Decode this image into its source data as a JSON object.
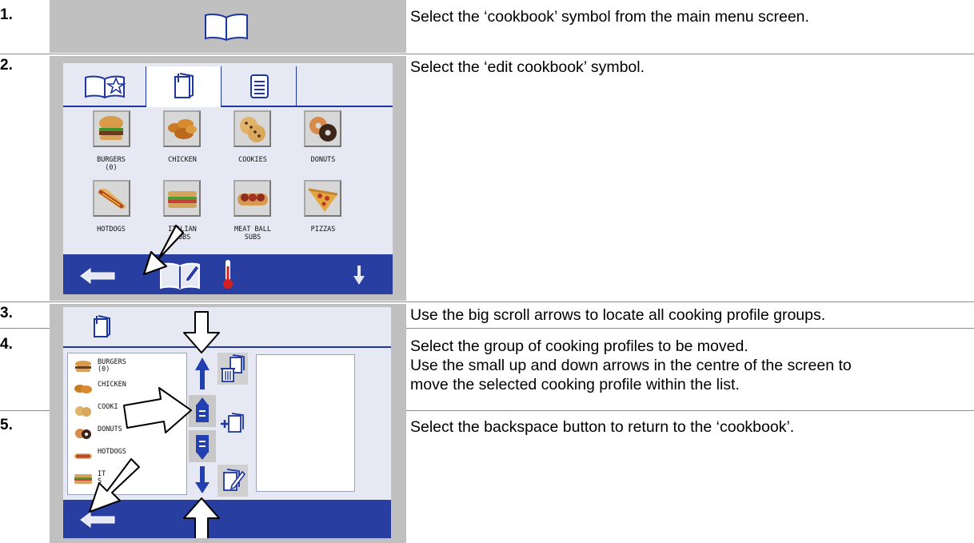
{
  "steps": [
    {
      "number": "1.",
      "text": "Select the ‘cookbook’ symbol from the main menu screen."
    },
    {
      "number": "2.",
      "text": "Select the ‘edit cookbook’ symbol."
    },
    {
      "number": "3.",
      "text": "Use the big scroll arrows to locate all cooking profile groups."
    },
    {
      "number": "4.",
      "text_line1": "Select the group of cooking profiles to be moved.",
      "text_line2": "Use the small up and down arrows in the centre of the screen to",
      "text_line3": "move the selected cooking profile within the list."
    },
    {
      "number": "5.",
      "text": "Select the backspace button to return to the ‘cookbook’."
    }
  ],
  "cookbook_grid": {
    "tiles": [
      {
        "label": "BURGERS\n(0)",
        "icon": "burger-icon"
      },
      {
        "label": "CHICKEN",
        "icon": "chicken-icon"
      },
      {
        "label": "COOKIES",
        "icon": "cookies-icon"
      },
      {
        "label": "DONUTS",
        "icon": "donuts-icon"
      },
      {
        "label": "HOTDOGS",
        "icon": "hotdog-icon"
      },
      {
        "label": "ITALIAN\nSUBS",
        "icon": "italian-sub-icon"
      },
      {
        "label": "MEAT BALL\nSUBS",
        "icon": "meatball-sub-icon"
      },
      {
        "label": "PIZZAS",
        "icon": "pizza-icon"
      }
    ]
  },
  "edit_list": {
    "items": [
      {
        "label": "BURGERS\n(0)",
        "icon": "burger-icon"
      },
      {
        "label": "CHICKEN",
        "icon": "chicken-icon"
      },
      {
        "label": "COOKI",
        "icon": "cookies-icon"
      },
      {
        "label": "DONUTS",
        "icon": "donuts-icon"
      },
      {
        "label": "HOTDOGS",
        "icon": "hotdog-icon"
      },
      {
        "label": "IT    AN\nS",
        "icon": "italian-sub-icon"
      }
    ]
  },
  "colors": {
    "panel_gray": "#c0c0c0",
    "screen_bg": "#e6e9f4",
    "nav_blue": "#283ea0",
    "outline_blue": "#1e36a0",
    "arrow_blue": "#2240b0",
    "thermometer_red": "#d62020"
  }
}
